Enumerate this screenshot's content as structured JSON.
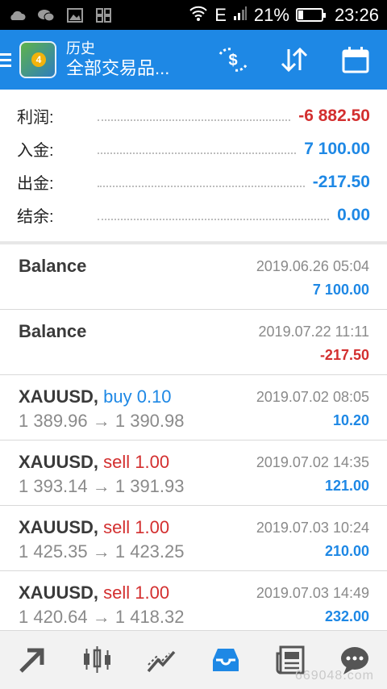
{
  "status_bar": {
    "icons": [
      "cloud-icon",
      "wechat-icon",
      "gallery-icon",
      "apps-icon"
    ],
    "network": "E",
    "battery_text": "21%",
    "battery_level": 0.21,
    "time": "23:26"
  },
  "toolbar": {
    "title_small": "历史",
    "title_large": "全部交易品...",
    "logo_badge": "4",
    "actions": [
      "exchange-dollar-icon",
      "sort-icon",
      "calendar-icon"
    ]
  },
  "summary": [
    {
      "label": "利润:",
      "value": "-6 882.50",
      "color": "#d32f2f"
    },
    {
      "label": "入金:",
      "value": "7 100.00",
      "color": "#1e88e5"
    },
    {
      "label": "出金:",
      "value": "-217.50",
      "color": "#1e88e5"
    },
    {
      "label": "结余:",
      "value": "0.00",
      "color": "#1e88e5"
    }
  ],
  "history": [
    {
      "symbol": "Balance",
      "type": "",
      "volume": "",
      "prices": "",
      "date": "2019.06.26 05:04",
      "amount": "7 100.00",
      "amount_color": "#1e88e5"
    },
    {
      "symbol": "Balance",
      "type": "",
      "volume": "",
      "prices": "",
      "date": "2019.07.22 11:11",
      "amount": "-217.50",
      "amount_color": "#d32f2f"
    },
    {
      "symbol": "XAUUSD,",
      "type": "buy 0.10",
      "type_color": "#1e88e5",
      "prices": "1 389.96 → 1 390.98",
      "date": "2019.07.02 08:05",
      "amount": "10.20",
      "amount_color": "#1e88e5"
    },
    {
      "symbol": "XAUUSD,",
      "type": "sell 1.00",
      "type_color": "#d32f2f",
      "prices": "1 393.14 → 1 391.93",
      "date": "2019.07.02 14:35",
      "amount": "121.00",
      "amount_color": "#1e88e5"
    },
    {
      "symbol": "XAUUSD,",
      "type": "sell 1.00",
      "type_color": "#d32f2f",
      "prices": "1 425.35 → 1 423.25",
      "date": "2019.07.03 10:24",
      "amount": "210.00",
      "amount_color": "#1e88e5"
    },
    {
      "symbol": "XAUUSD,",
      "type": "sell 1.00",
      "type_color": "#d32f2f",
      "prices": "1 420.64 → 1 418.32",
      "date": "2019.07.03 14:49",
      "amount": "232.00",
      "amount_color": "#1e88e5"
    }
  ],
  "bottom_nav": [
    "trade-icon",
    "chart-icon",
    "trend-icon",
    "history-inbox-icon",
    "news-icon",
    "chat-icon"
  ],
  "watermark": "669048.com"
}
